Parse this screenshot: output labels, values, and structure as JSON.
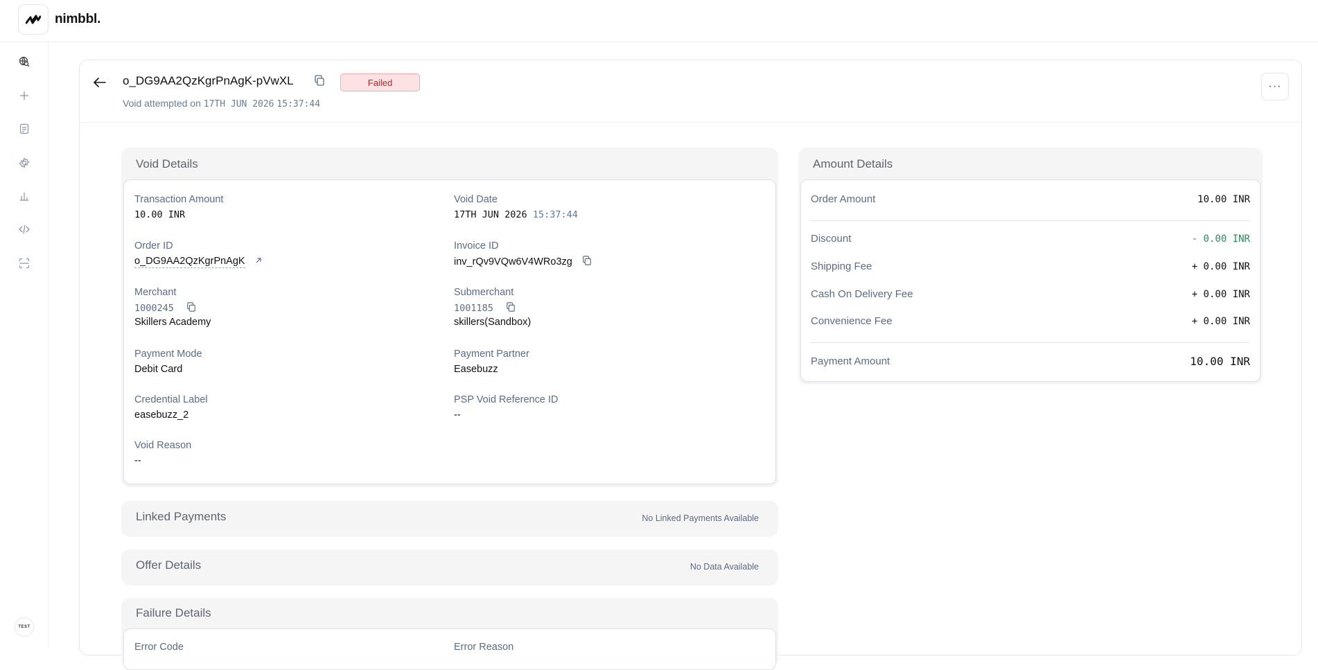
{
  "brand": {
    "name": "nimbbl."
  },
  "sidebar": {
    "icons": [
      "globe-search-icon",
      "plus-icon",
      "document-icon",
      "settings-icon",
      "analytics-icon",
      "code-icon",
      "scan-icon"
    ],
    "env_badge": "TEST"
  },
  "header": {
    "order_id": "o_DG9AA2QzKgrPnAgK-pVwXL",
    "status": "Failed",
    "attempt_label": "Void attempted on",
    "attempt_date": "17TH JUN 2026",
    "attempt_time": "15:37:44",
    "more_label": "···"
  },
  "void_details": {
    "title": "Void Details",
    "transaction_amount": {
      "label": "Transaction Amount",
      "value": "10.00 INR"
    },
    "void_date": {
      "label": "Void Date",
      "date": "17TH JUN 2026",
      "time": "15:37:44"
    },
    "order_id": {
      "label": "Order ID",
      "value": "o_DG9AA2QzKgrPnAgK"
    },
    "invoice_id": {
      "label": "Invoice ID",
      "value": "inv_rQv9VQw6V4WRo3zg"
    },
    "merchant": {
      "label": "Merchant",
      "id": "1000245",
      "name": "Skillers Academy"
    },
    "submerchant": {
      "label": "Submerchant",
      "id": "1001185",
      "name": "skillers(Sandbox)"
    },
    "payment_mode": {
      "label": "Payment Mode",
      "value": "Debit Card"
    },
    "payment_partner": {
      "label": "Payment Partner",
      "value": "Easebuzz"
    },
    "credential_label": {
      "label": "Credential Label",
      "value": "easebuzz_2"
    },
    "psp_void_ref": {
      "label": "PSP Void Reference ID",
      "value": "--"
    },
    "void_reason": {
      "label": "Void Reason",
      "value": "--"
    }
  },
  "linked_payments": {
    "title": "Linked Payments",
    "note": "No Linked Payments Available"
  },
  "offer_details": {
    "title": "Offer Details",
    "note": "No Data Available"
  },
  "failure_details": {
    "title": "Failure Details",
    "error_code_label": "Error Code",
    "error_reason_label": "Error Reason"
  },
  "amount_details": {
    "title": "Amount Details",
    "order_amount": {
      "label": "Order Amount",
      "value": "10.00 INR"
    },
    "discount": {
      "label": "Discount",
      "value": "- 0.00 INR"
    },
    "shipping_fee": {
      "label": "Shipping Fee",
      "value": "+ 0.00 INR"
    },
    "cod_fee": {
      "label": "Cash On Delivery Fee",
      "value": "+ 0.00 INR"
    },
    "convenience_fee": {
      "label": "Convenience Fee",
      "value": "+ 0.00 INR"
    },
    "payment_amount": {
      "label": "Payment Amount",
      "value": "10.00 INR"
    }
  },
  "colors": {
    "failed_bg": "#fde2e4",
    "failed_text": "#b4232f",
    "discount": "#2a8a5a",
    "label": "#5b6b86"
  }
}
